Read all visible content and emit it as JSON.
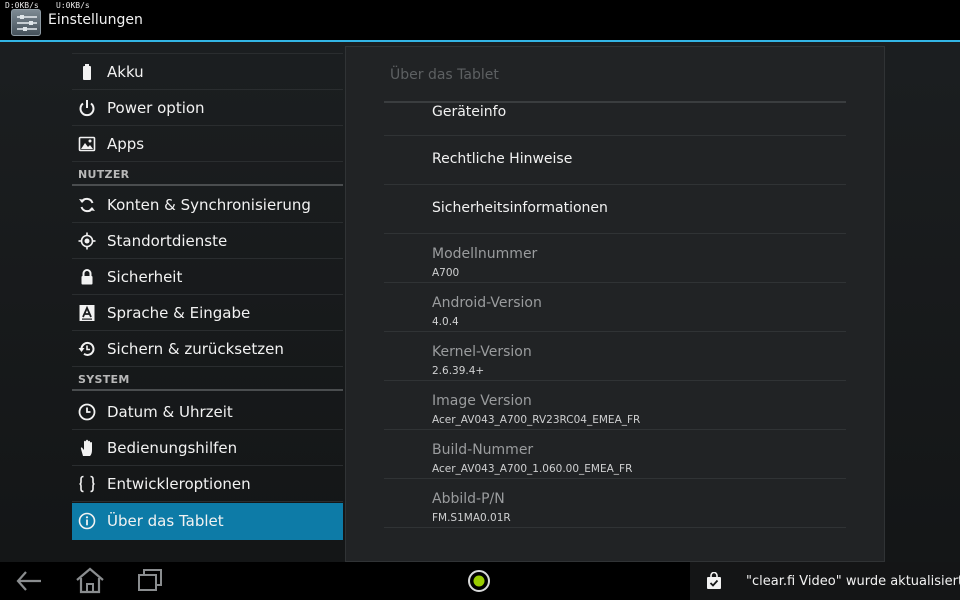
{
  "status": {
    "net_down": "D:0KB/s",
    "net_up": "U:0KB/s"
  },
  "actionbar": {
    "title": "Einstellungen",
    "icon": "settings-sliders-icon"
  },
  "sidebar": {
    "items": [
      {
        "label": "Akku",
        "icon": "battery-icon"
      },
      {
        "label": "Power option",
        "icon": "power-icon"
      },
      {
        "label": "Apps",
        "icon": "apps-icon"
      },
      {
        "section": "NUTZER"
      },
      {
        "label": "Konten & Synchronisierung",
        "icon": "sync-icon"
      },
      {
        "label": "Standortdienste",
        "icon": "location-icon"
      },
      {
        "label": "Sicherheit",
        "icon": "lock-icon"
      },
      {
        "label": "Sprache & Eingabe",
        "icon": "keyboard-letter-icon"
      },
      {
        "label": "Sichern & zurücksetzen",
        "icon": "backup-restore-icon"
      },
      {
        "section": "SYSTEM"
      },
      {
        "label": "Datum & Uhrzeit",
        "icon": "clock-icon"
      },
      {
        "label": "Bedienungshilfen",
        "icon": "hand-icon"
      },
      {
        "label": "Entwickleroptionen",
        "icon": "braces-icon"
      },
      {
        "label": "Über das Tablet",
        "icon": "info-icon",
        "selected": true
      }
    ]
  },
  "panel": {
    "title": "Über das Tablet",
    "items": [
      {
        "title": "Geräteinfo"
      },
      {
        "title": "Rechtliche Hinweise"
      },
      {
        "title": "Sicherheitsinformationen"
      },
      {
        "title": "Modellnummer",
        "value": "A700"
      },
      {
        "title": "Android-Version",
        "value": "4.0.4"
      },
      {
        "title": "Kernel-Version",
        "value": "2.6.39.4+"
      },
      {
        "title": "Image Version",
        "value": "Acer_AV043_A700_RV23RC04_EMEA_FR"
      },
      {
        "title": "Build-Nummer",
        "value": "Acer_AV043_A700_1.060.00_EMEA_FR"
      },
      {
        "title": "Abbild-P/N",
        "value": "FM.S1MA0.01R"
      }
    ]
  },
  "navbar": {
    "buttons": [
      "back-icon",
      "home-icon",
      "recent-apps-icon"
    ],
    "status_icon": "status-ring-icon"
  },
  "notification": {
    "icon": "shopping-bag-check-icon",
    "text": "\"clear.fi Video\" wurde aktualisiert."
  },
  "colors": {
    "accent": "#33b5e5",
    "selected_row": "#0d7ba7",
    "status_ring": "#99cc00"
  }
}
